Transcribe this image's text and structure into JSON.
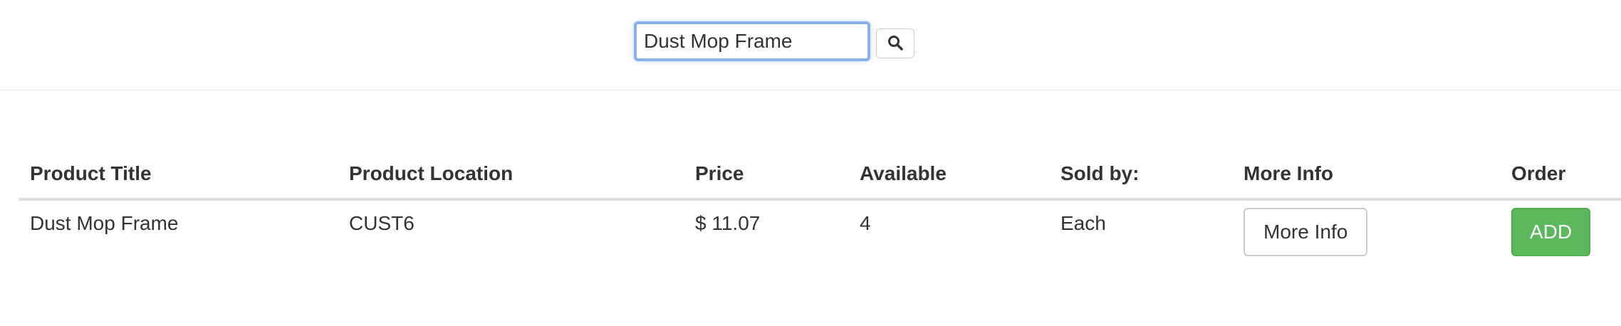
{
  "search": {
    "value": "Dust Mop Frame",
    "icon": "search-icon"
  },
  "table": {
    "headers": {
      "title": "Product Title",
      "location": "Product Location",
      "price": "Price",
      "available": "Available",
      "sold_by": "Sold by:",
      "more_info": "More Info",
      "order": "Order"
    },
    "rows": [
      {
        "title": "Dust Mop Frame",
        "location": "CUST6",
        "price": "$ 11.07",
        "available": "4",
        "sold_by": "Each",
        "more_info_label": "More Info",
        "order_label": "ADD"
      }
    ]
  },
  "colors": {
    "focus_border": "#8ab0ea",
    "add_button": "#5cb85c",
    "header_rule": "#dddddd"
  }
}
